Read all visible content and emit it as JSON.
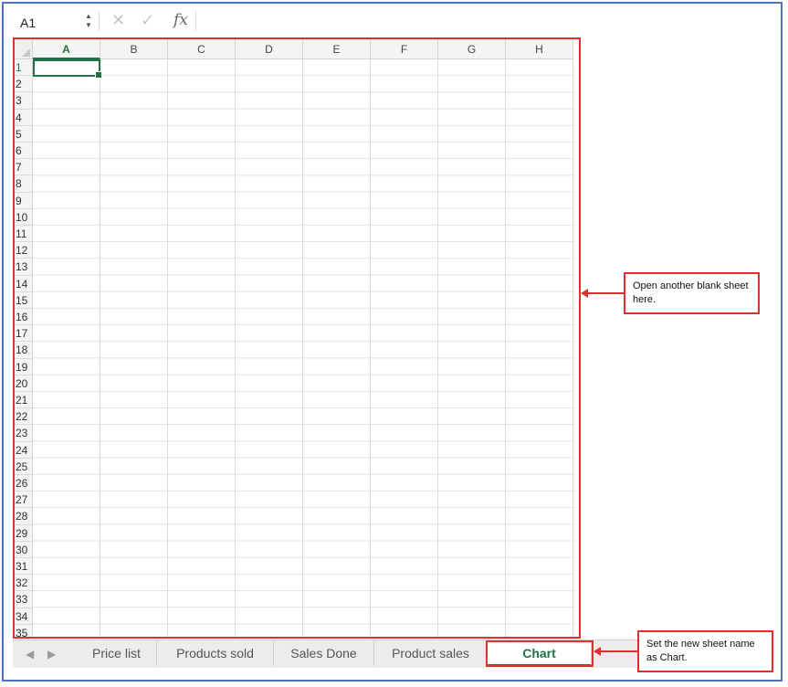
{
  "formula_bar": {
    "name_box": "A1",
    "stepper_up": "▲",
    "stepper_down": "▼",
    "cancel_icon": "✕",
    "confirm_icon": "✓",
    "fx_label": "fx"
  },
  "grid": {
    "columns": [
      "A",
      "B",
      "C",
      "D",
      "E",
      "F",
      "G",
      "H"
    ],
    "rows": [
      "1",
      "2",
      "3",
      "4",
      "5",
      "6",
      "7",
      "8",
      "9",
      "10",
      "11",
      "12",
      "13",
      "14",
      "15",
      "16",
      "17",
      "18",
      "19",
      "20",
      "21",
      "22",
      "23",
      "24",
      "25",
      "26",
      "27",
      "28",
      "29",
      "30",
      "31",
      "32",
      "33",
      "34",
      "35"
    ],
    "active_column": "A",
    "active_row": "1"
  },
  "sheet_tabs": {
    "nav_prev": "◀",
    "nav_next": "▶",
    "tabs": [
      "Price list",
      "Products sold",
      "Sales Done",
      "Product sales",
      "Chart"
    ],
    "active": "Chart"
  },
  "annotations": {
    "grid_callout": "Open another blank sheet here.",
    "tab_callout": "Set the new sheet name as Chart."
  },
  "colors": {
    "accent": "#217346",
    "annotation": "#e03030",
    "frame": "#4a76b8"
  }
}
